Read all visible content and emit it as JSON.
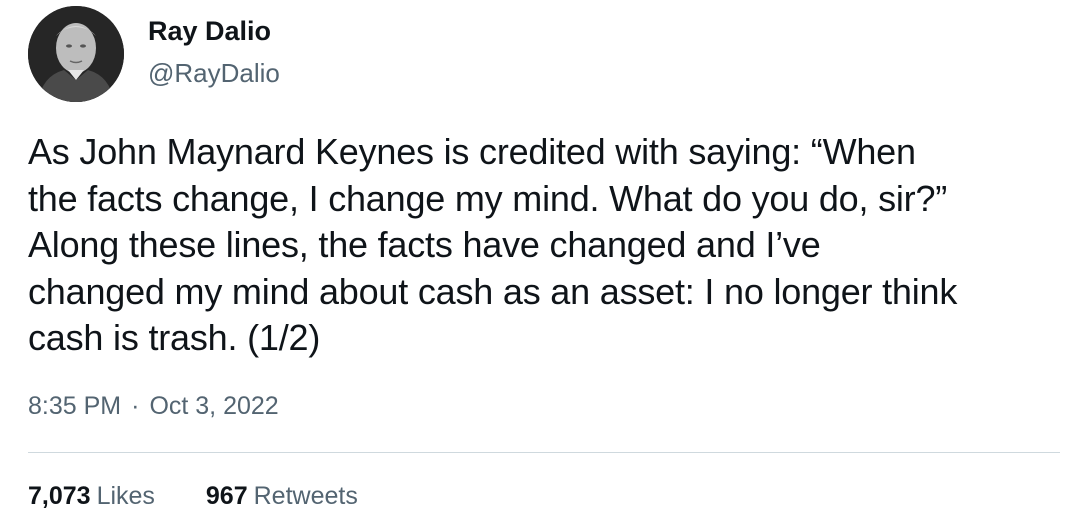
{
  "author": {
    "display_name": "Ray Dalio",
    "handle": "@RayDalio",
    "avatar_icon": "profile-photo"
  },
  "tweet": {
    "lines": [
      "As John Maynard Keynes is credited with saying: “When",
      "the facts change, I change my mind. What do you do, sir?”",
      "Along these lines, the facts have changed  and I’ve",
      "changed my mind about cash as an asset: I no longer think",
      "cash is trash. (1/2)"
    ],
    "time": "8:35 PM",
    "separator": "·",
    "date": "Oct 3, 2022"
  },
  "stats": {
    "likes_count": "7,073",
    "likes_label": "Likes",
    "retweets_count": "967",
    "retweets_label": "Retweets"
  },
  "colors": {
    "text": "#0f1419",
    "secondary": "#536471",
    "divider": "#cfd9de"
  }
}
